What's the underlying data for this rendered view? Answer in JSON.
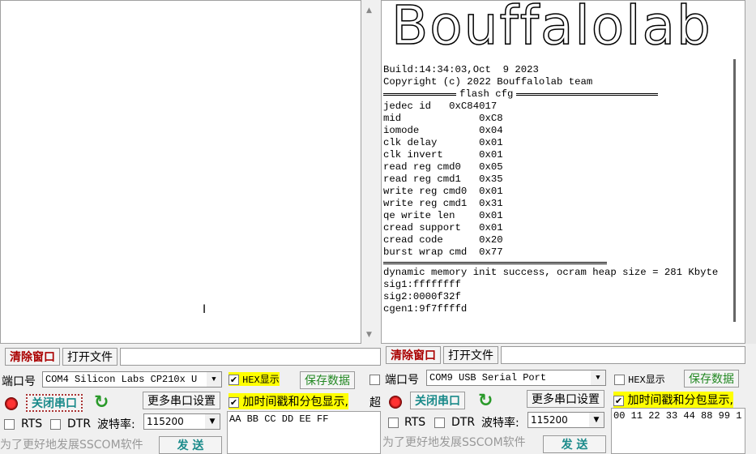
{
  "left": {
    "clear_label": "清除窗口",
    "open_file_label": "打开文件",
    "port_label": "端口号",
    "port_value": "COM4 Silicon Labs CP210x U",
    "hex_label": "HEX显示",
    "hex_checked": true,
    "save_label": "保存数据",
    "close_port_label": "关闭串口",
    "more_settings_label": "更多串口设置",
    "timestamp_label": "加时间戳和分包显示,",
    "extra_label": "超",
    "rts_label": "RTS",
    "dtr_label": "DTR",
    "baud_label": "波特率:",
    "baud_value": "115200",
    "send_data": "AA BB CC DD EE FF",
    "promo": "为了更好地发展SSCOM软件",
    "send_label": "发 送"
  },
  "right": {
    "logo": "Bouffalolab",
    "log": [
      "Build:14:34:03,Oct  9 2023",
      "Copyright (c) 2022 Bouffalolab team"
    ],
    "flash_header": "flash cfg",
    "flash": [
      "jedec id   0xC84017",
      "mid             0xC8",
      "iomode          0x04",
      "clk delay       0x01",
      "clk invert      0x01",
      "read reg cmd0   0x05",
      "read reg cmd1   0x35",
      "write reg cmd0  0x01",
      "write reg cmd1  0x31",
      "qe write len    0x01",
      "cread support   0x01",
      "cread code      0x20",
      "burst wrap cmd  0x77"
    ],
    "after": [
      "dynamic memory init success, ocram heap size = 281 Kbyte",
      "sig1:ffffffff",
      "sig2:0000f32f",
      "cgen1:9f7ffffd"
    ],
    "clear_label": "清除窗口",
    "open_file_label": "打开文件",
    "port_label": "端口号",
    "port_value": "COM9 USB Serial Port",
    "hex_label": "HEX显示",
    "hex_checked": false,
    "save_label": "保存数据",
    "close_port_label": "关闭串口",
    "more_settings_label": "更多串口设置",
    "timestamp_label": "加时间戳和分包显示,",
    "rts_label": "RTS",
    "dtr_label": "DTR",
    "baud_label": "波特率:",
    "baud_value": "115200",
    "send_data": "00 11 22 33 44 88 99 1",
    "promo": "为了更好地发展SSCOM软件",
    "send_label": "发 送"
  }
}
